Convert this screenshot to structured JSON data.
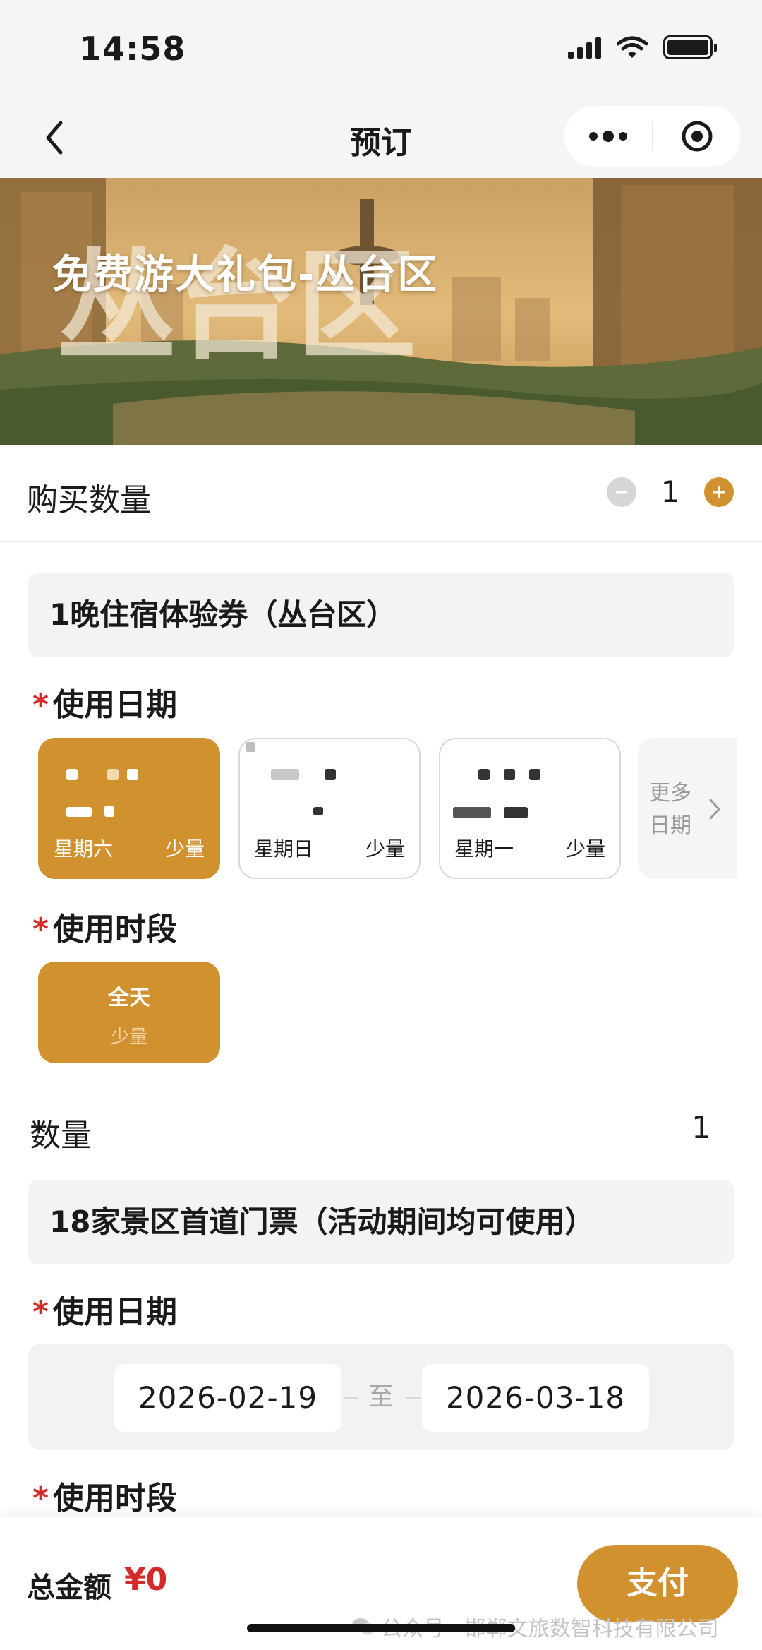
{
  "status_bar": {
    "time": "14:58"
  },
  "nav": {
    "title": "预订"
  },
  "banner": {
    "title": "免费游大礼包-丛台区",
    "backdrop_text": "丛台区"
  },
  "purchase": {
    "label": "购买数量",
    "value": "1"
  },
  "item1": {
    "name": "1晚住宿体验券（丛台区）",
    "date_label": "使用日期",
    "dates": [
      {
        "weekday": "星期六",
        "stock": "少量",
        "selected": true
      },
      {
        "weekday": "星期日",
        "stock": "少量",
        "selected": false
      },
      {
        "weekday": "星期一",
        "stock": "少量",
        "selected": false
      }
    ],
    "more_dates": "更多日期",
    "period_label": "使用时段",
    "period": {
      "name": "全天",
      "stock": "少量"
    },
    "quantity_label": "数量",
    "quantity_value": "1"
  },
  "item2": {
    "name": "18家景区首道门票（活动期间均可使用）",
    "date_label": "使用日期",
    "start_date": "2026-02-19",
    "to": "至",
    "end_date": "2026-03-18",
    "period_label": "使用时段"
  },
  "footer": {
    "total_label": "总金额",
    "total_value": "¥0",
    "pay_label": "支付",
    "watermark": "公众号 · 邯郸文旅数智科技有限公司"
  },
  "colors": {
    "accent": "#d1912f",
    "price": "#d42a2a",
    "panel": "#f3f3f3"
  }
}
